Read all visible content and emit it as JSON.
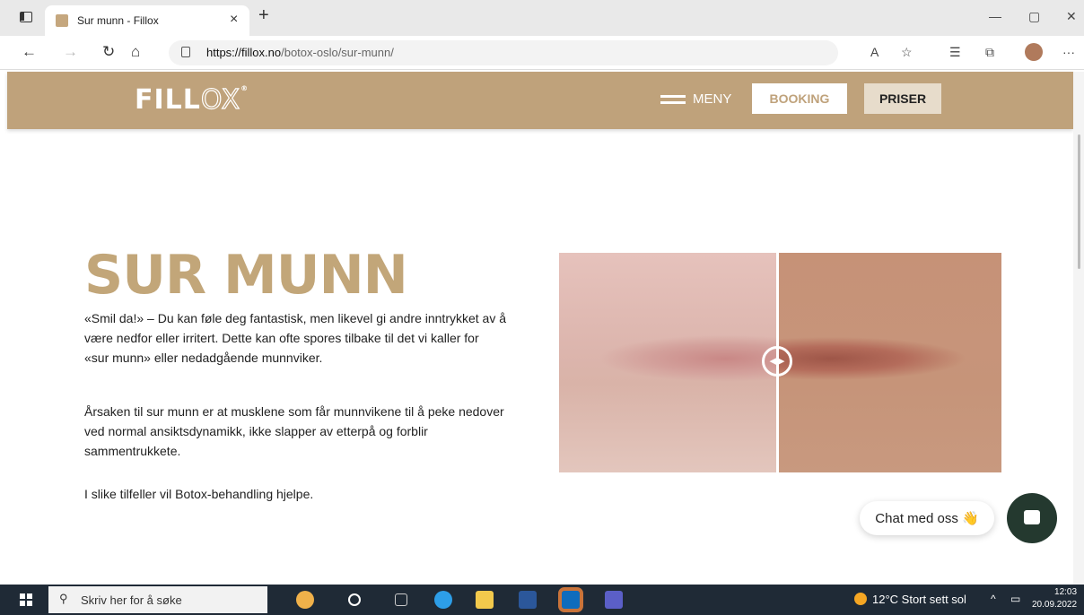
{
  "browser": {
    "tab_title": "Sur munn - Fillox",
    "tab_close": "×",
    "new_tab": "+",
    "url_host": "https://fillox.no",
    "url_path": "/botox-oslo/sur-munn/"
  },
  "site": {
    "logo_main": "FILL",
    "logo_ox": "OX",
    "logo_reg": "®",
    "menu_label": "MENY",
    "booking_label": "BOOKING",
    "priser_label": "PRISER"
  },
  "article": {
    "title": "SUR MUNN",
    "paragraphs": [
      "«Smil da!» – Du kan føle deg fantastisk, men likevel gi andre inntrykket av å være nedfor eller irritert. Dette kan ofte spores tilbake til det vi kaller for «sur munn» eller nedadgående munnviker.",
      "Årsaken til sur munn er at musklene som får munnvikene til å peke nedover ved normal ansiktsdynamikk, ikke slapper av etterpå og forblir sammentrukkete.",
      "I slike tilfeller vil Botox-behandling hjelpe."
    ]
  },
  "chat": {
    "label": "Chat med oss",
    "emoji": "👋"
  },
  "taskbar": {
    "search_placeholder": "Skriv her for å søke",
    "weather": "12°C  Stort sett sol",
    "time": "12:03",
    "date": "20.09.2022"
  }
}
